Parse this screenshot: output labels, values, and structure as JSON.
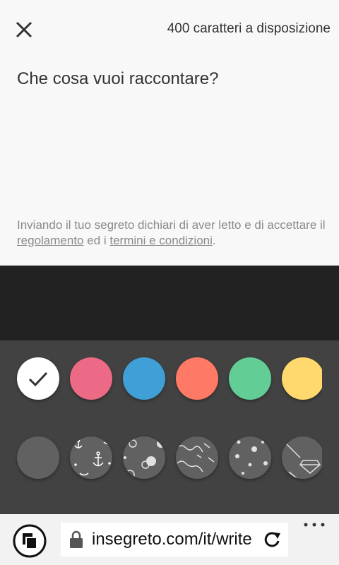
{
  "header": {
    "close_icon": "close-icon",
    "char_counter": "400 caratteri a disposizione"
  },
  "editor": {
    "placeholder": "Che cosa vuoi raccontare?"
  },
  "legal": {
    "text_before": "Inviando il tuo segreto dichiari di aver letto e di accettare il ",
    "link_rules": "regolamento",
    "text_middle": " ed i ",
    "link_terms": "termini e condizioni",
    "text_after": "."
  },
  "colors": {
    "background_light": "#f8f8f8",
    "dark_band": "#222222",
    "palette_bg": "#424242",
    "swatches": [
      "#ffffff",
      "#ec6a86",
      "#3f9fd6",
      "#ff7a66",
      "#62cd94",
      "#ffd86e"
    ],
    "pattern_base": "#616161",
    "selected": "#ffffff"
  },
  "patterns": [
    "plain",
    "anchors",
    "bubbles",
    "waves",
    "dots",
    "diamonds"
  ],
  "browser": {
    "tabs_icon": "tabs-icon",
    "lock_icon": "lock-icon",
    "url": "insegreto.com/it/write",
    "reload_icon": "reload-icon",
    "more_icon": "more-dots-icon"
  }
}
